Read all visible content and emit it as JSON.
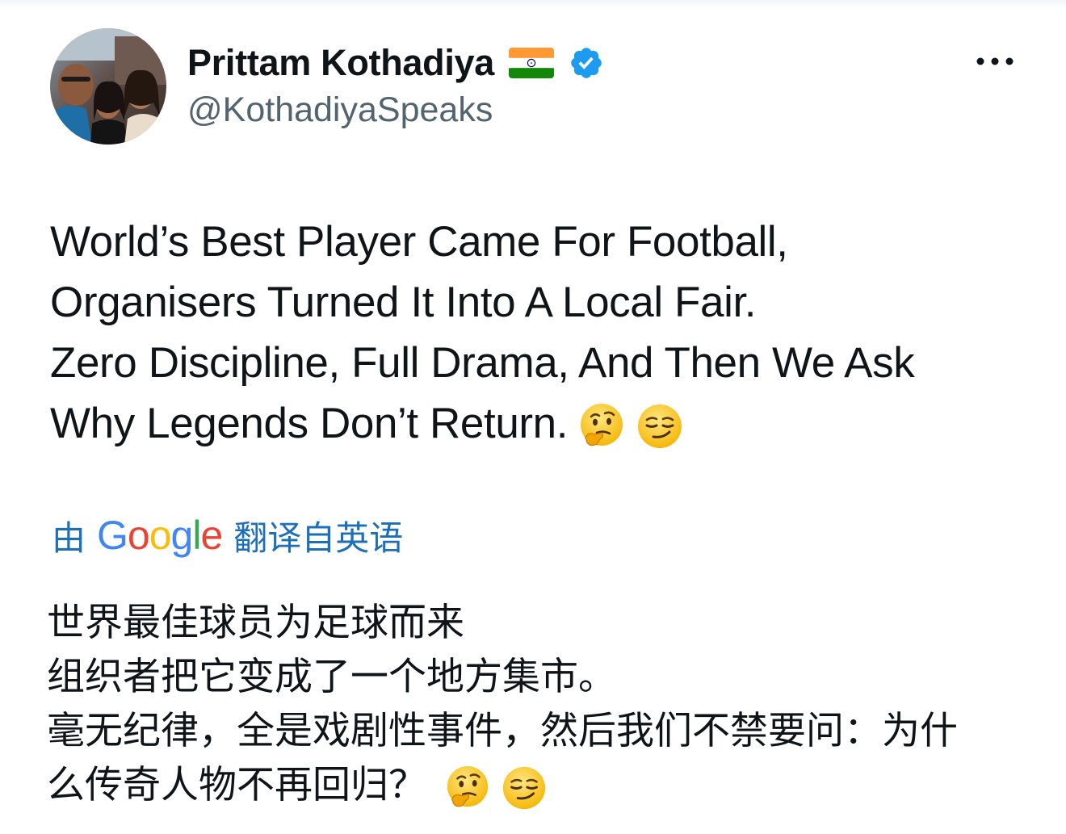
{
  "author": {
    "display_name": "Prittam Kothadiya",
    "handle": "@KothadiyaSpeaks",
    "flag": "india-flag",
    "badge": "verified-badge"
  },
  "menu": {
    "icon": "more-horizontal-icon"
  },
  "post": {
    "lines": [
      "World’s Best Player Came For Football,",
      "Organisers Turned It Into A Local Fair.",
      "Zero Discipline, Full Drama, And Then We Ask",
      "Why Legends Don’t Return."
    ],
    "emojis": [
      "thinking-face-emoji",
      "smirking-face-emoji"
    ]
  },
  "translation": {
    "prefix": "由",
    "provider": "Google",
    "suffix": "翻译自英语",
    "lines": [
      "世界最佳球员为足球而来",
      "组织者把它变成了一个地方集市。",
      "毫无纪律，全是戏剧性事件，然后我们不禁要问：为什",
      "么传奇人物不再回归？"
    ],
    "emojis": [
      "thinking-face-emoji",
      "smirking-face-emoji"
    ]
  },
  "colors": {
    "text": "#0f1419",
    "secondary_text": "#536471",
    "translate_link": "#1d6fb8",
    "verified_blue": "#1d9bf0",
    "google_blue": "#4285f4",
    "google_red": "#ea4335",
    "google_yellow": "#fbbc05",
    "google_green": "#34a853"
  }
}
